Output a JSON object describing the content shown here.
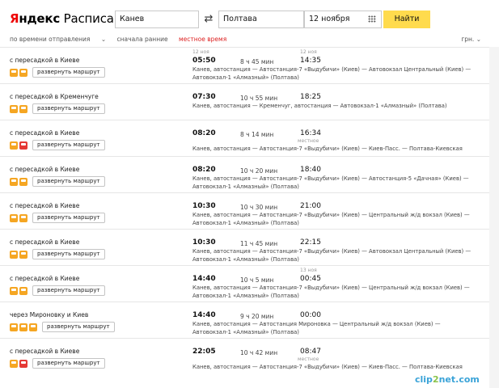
{
  "header": {
    "logo_ya": "Я",
    "logo_ndeks": "ндекс",
    "logo_service": "Расписания",
    "from": "Канев",
    "to": "Полтава",
    "date": "12 ноября",
    "find_label": "Найти"
  },
  "filters": {
    "sort_time": "по времени отправления",
    "early_first": "сначала ранние",
    "local_time": "местное время",
    "currency": "грн."
  },
  "routes": [
    {
      "desc": "с пересадкой в Киеве",
      "icons": [
        "bus",
        "bus"
      ],
      "btn": "развернуть маршрут",
      "dep_note": "12 ноя",
      "dep": "05:50",
      "dur": "8 ч 45 мин",
      "arr_note": "12 ноя",
      "arr": "14:35",
      "stops": "Канев, автостанция — Автостанция-7 «Выдубичи» (Киев) — Автовокзал Центральный (Киев) — Автовокзал-1 «Алмазный» (Полтава)"
    },
    {
      "desc": "с пересадкой в Кременчуге",
      "icons": [
        "bus",
        "bus"
      ],
      "btn": "развернуть маршрут",
      "dep": "07:30",
      "dur": "10 ч 55 мин",
      "arr": "18:25",
      "stops": "Канев, автостанция — Кременчуг, автостанция — Автовокзал-1 «Алмазный» (Полтава)"
    },
    {
      "desc": "с пересадкой в Киеве",
      "icons": [
        "bus",
        "train"
      ],
      "btn": "развернуть маршрут",
      "dep": "08:20",
      "dur": "8 ч 14 мин",
      "arr": "16:34",
      "arr_note2": "местное",
      "stops": "Канев, автостанция — Автостанция-7 «Выдубичи» (Киев) — Киев-Пасс. — Полтава-Киевская"
    },
    {
      "desc": "с пересадкой в Киеве",
      "icons": [
        "bus",
        "bus"
      ],
      "btn": "развернуть маршрут",
      "dep": "08:20",
      "dur": "10 ч 20 мин",
      "arr": "18:40",
      "stops": "Канев, автостанция — Автостанция-7 «Выдубичи» (Киев) — Автостанция-5 «Дачная» (Киев) — Автовокзал-1 «Алмазный» (Полтава)"
    },
    {
      "desc": "с пересадкой в Киеве",
      "icons": [
        "bus",
        "bus"
      ],
      "btn": "развернуть маршрут",
      "dep": "10:30",
      "dur": "10 ч 30 мин",
      "arr": "21:00",
      "stops": "Канев, автостанция — Автостанция-7 «Выдубичи» (Киев) — Центральный ж/д вокзал (Киев) — Автовокзал-1 «Алмазный» (Полтава)"
    },
    {
      "desc": "с пересадкой в Киеве",
      "icons": [
        "bus",
        "bus"
      ],
      "btn": "развернуть маршрут",
      "dep": "10:30",
      "dur": "11 ч 45 мин",
      "arr": "22:15",
      "stops": "Канев, автостанция — Автостанция-7 «Выдубичи» (Киев) — Автовокзал Центральный (Киев) — Автовокзал-1 «Алмазный» (Полтава)"
    },
    {
      "desc": "с пересадкой в Киеве",
      "icons": [
        "bus",
        "bus"
      ],
      "btn": "развернуть маршрут",
      "dep": "14:40",
      "dur": "10 ч 5 мин",
      "arr_note": "13 ноя",
      "arr": "00:45",
      "stops": "Канев, автостанция — Автостанция-7 «Выдубичи» (Киев) — Центральный ж/д вокзал (Киев) — Автовокзал-1 «Алмазный» (Полтава)"
    },
    {
      "desc": "через Мироновку и Киев",
      "icons": [
        "bus",
        "bus",
        "bus"
      ],
      "btn": "развернуть маршрут",
      "dep": "14:40",
      "dur": "9 ч 20 мин",
      "arr": "00:00",
      "stops": "Канев, автостанция — Автостанция Мироновка — Центральный ж/д вокзал (Киев) — Автовокзал-1 «Алмазный» (Полтава)"
    },
    {
      "desc": "с пересадкой в Киеве",
      "icons": [
        "bus",
        "train"
      ],
      "btn": "развернуть маршрут",
      "dep": "22:05",
      "dur": "10 ч 42 мин",
      "arr": "08:47",
      "arr_note2": "местное",
      "stops": "Канев, автостанция — Автостанция-7 «Выдубичи» (Киев) — Киев-Пасс. — Полтава-Киевская"
    }
  ],
  "watermark": {
    "a": "clip",
    "b": "2",
    "c": "net.com"
  }
}
